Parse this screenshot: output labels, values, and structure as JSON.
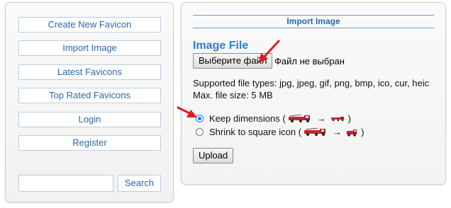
{
  "sidebar": {
    "items": [
      {
        "label": "Create New Favicon"
      },
      {
        "label": "Import Image"
      },
      {
        "label": "Latest Favicons"
      },
      {
        "label": "Top Rated Favicons"
      },
      {
        "label": "Login"
      },
      {
        "label": "Register"
      }
    ],
    "search": {
      "placeholder": "",
      "value": "",
      "button_label": "Search"
    }
  },
  "panel": {
    "header": "Import Image",
    "section_title": "Image File",
    "file_button_label": "Выберите файл",
    "file_status": "Файл не выбран",
    "supported_types": "Supported file types: jpg, jpeg, gif, png, bmp, ico, cur, heic",
    "max_size": "Max. file size: 5 MB",
    "options": [
      {
        "label": "Keep dimensions (",
        "suffix": ")",
        "checked": true
      },
      {
        "label": "Shrink to square icon (",
        "suffix": ")",
        "checked": false
      }
    ],
    "arrow_glyph": "→",
    "upload_label": "Upload"
  },
  "colors": {
    "link": "#2a67a8",
    "accent": "#2a7fd4",
    "annotation_arrow": "#e01b1b",
    "truck": "#c0282d"
  }
}
